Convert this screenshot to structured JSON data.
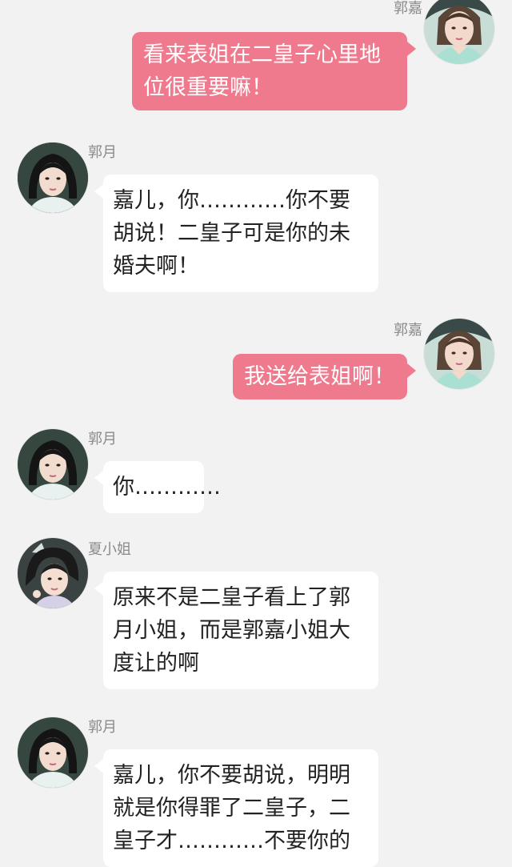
{
  "messages": [
    {
      "sender": "郭嘉",
      "text": "看来表姐在二皇子心里地位很重要嘛！",
      "side": "right",
      "avatar_icon": "guo-jia-avatar-icon"
    },
    {
      "sender": "郭月",
      "text": "嘉儿，你…………你不要胡说！二皇子可是你的未婚夫啊！",
      "side": "left",
      "avatar_icon": "guo-yue-avatar-icon"
    },
    {
      "sender": "郭嘉",
      "text": "我送给表姐啊！",
      "side": "right",
      "avatar_icon": "guo-jia-avatar-icon"
    },
    {
      "sender": "郭月",
      "text": "你…………",
      "side": "left",
      "avatar_icon": "guo-yue-avatar-icon"
    },
    {
      "sender": "夏小姐",
      "text": "原来不是二皇子看上了郭月小姐，而是郭嘉小姐大度让的啊",
      "side": "left",
      "avatar_icon": "xia-xiaojie-avatar-icon"
    },
    {
      "sender": "郭月",
      "text": "嘉儿，你不要胡说，明明就是你得罪了二皇子，二皇子才…………不要你的",
      "side": "left",
      "avatar_icon": "guo-yue-avatar-icon"
    }
  ],
  "colors": {
    "background": "#f2f2f2",
    "right_bubble": "#f07a8d",
    "left_bubble": "#ffffff",
    "sender_text": "#8a8a8a"
  }
}
